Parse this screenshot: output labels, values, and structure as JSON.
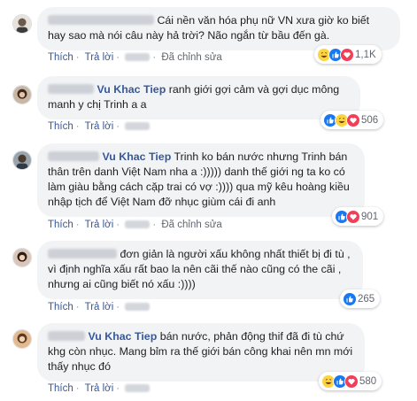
{
  "colors": {
    "link": "#385898",
    "bubble": "#f2f3f5",
    "muted": "#606770"
  },
  "comments": [
    {
      "name": "",
      "text": "Cái nền văn hóa phụ nữ VN xưa giờ ko biết hay sao mà nói câu này hả trời? Não ngắn từ bầu đến gà.",
      "actions": [
        "Thích",
        "Trả lời",
        "Đã chỉnh sửa"
      ],
      "reactions": [
        "haha-icon",
        "like-icon",
        "heart-icon"
      ],
      "count": "1,1K"
    },
    {
      "name": "Vu Khac Tiep",
      "text": "ranh giới gợi cảm và gợi dục mông manh y chị Trinh a a",
      "actions": [
        "Thích",
        "Trả lời"
      ],
      "reactions": [
        "like-icon",
        "haha-icon",
        "heart-icon"
      ],
      "count": "506"
    },
    {
      "name": "Vu Khac Tiep",
      "text": "Trinh ko bán nước nhưng Trinh bán thân trên danh Việt Nam nha a :))))) danh thế giới ng ta ko có làm giàu bằng cách cặp trai có vợ :)))) qua mỹ kêu hoàng kiều nhập tịch để Việt Nam đỡ nhục giùm cái đi anh",
      "actions": [
        "Thích",
        "Trả lời",
        "Đã chỉnh sửa"
      ],
      "reactions": [
        "like-icon",
        "heart-icon"
      ],
      "count": "901"
    },
    {
      "name": "",
      "text": "đơn giản là người xấu không nhất thiết bị đi tù , vì định nghĩa xấu rất bao la nên cãi thế nào cũng có the cãi , nhưng ai cũng biết nó xấu :))))",
      "actions": [
        "Thích",
        "Trả lời"
      ],
      "reactions": [
        "like-icon"
      ],
      "count": "265"
    },
    {
      "name": "Vu Khac Tiep",
      "text": "bán nước, phản động thif đã đi tù chứ khg còn nhục. Mang bỉm ra thế giới bán công khai nên mn mới thấy nhục đó",
      "actions": [
        "Thích",
        "Trả lời"
      ],
      "reactions": [
        "haha-icon",
        "like-icon",
        "heart-icon"
      ],
      "count": "580"
    }
  ]
}
